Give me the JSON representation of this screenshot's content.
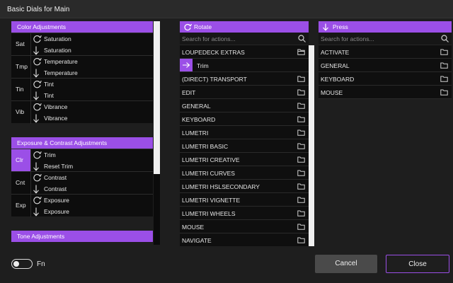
{
  "window": {
    "title": "Basic Dials for Main"
  },
  "left": {
    "sections": [
      {
        "header": "Color Adjustments",
        "rows": [
          {
            "label": "Sat",
            "rotate": "Saturation",
            "press": "Saturation",
            "active": false
          },
          {
            "label": "Tmp",
            "rotate": "Temperature",
            "press": "Temperature",
            "active": false
          },
          {
            "label": "Tin",
            "rotate": "Tint",
            "press": "Tint",
            "active": false
          },
          {
            "label": "Vib",
            "rotate": "Vibrance",
            "press": "Vibrance",
            "active": false
          }
        ]
      },
      {
        "header": "Exposure & Contrast Adjustments",
        "rows": [
          {
            "label": "Clr",
            "rotate": "Trim",
            "press": "Reset Trim",
            "active": true
          },
          {
            "label": "Cnt",
            "rotate": "Contrast",
            "press": "Contrast",
            "active": false
          },
          {
            "label": "Exp",
            "rotate": "Exposure",
            "press": "Exposure",
            "active": false
          }
        ]
      },
      {
        "header": "Tone Adjustments",
        "rows": []
      }
    ]
  },
  "rotate": {
    "header": "Rotate",
    "search_placeholder": "Search for actions...",
    "items": [
      {
        "label": "LOUPEDECK EXTRAS",
        "type": "folder-open"
      },
      {
        "label": "Trim",
        "type": "child"
      },
      {
        "label": "(DIRECT) TRANSPORT",
        "type": "folder"
      },
      {
        "label": "EDIT",
        "type": "folder"
      },
      {
        "label": "GENERAL",
        "type": "folder"
      },
      {
        "label": "KEYBOARD",
        "type": "folder"
      },
      {
        "label": "LUMETRI",
        "type": "folder"
      },
      {
        "label": "LUMETRI BASIC",
        "type": "folder"
      },
      {
        "label": "LUMETRI CREATIVE",
        "type": "folder"
      },
      {
        "label": "LUMETRI CURVES",
        "type": "folder"
      },
      {
        "label": "LUMETRI HSLSECONDARY",
        "type": "folder"
      },
      {
        "label": "LUMETRI VIGNETTE",
        "type": "folder"
      },
      {
        "label": "LUMETRI WHEELS",
        "type": "folder"
      },
      {
        "label": "MOUSE",
        "type": "folder"
      },
      {
        "label": "NAVIGATE",
        "type": "folder"
      }
    ]
  },
  "press": {
    "header": "Press",
    "search_placeholder": "Search for actions...",
    "items": [
      {
        "label": "ACTIVATE",
        "type": "folder"
      },
      {
        "label": "GENERAL",
        "type": "folder"
      },
      {
        "label": "KEYBOARD",
        "type": "folder"
      },
      {
        "label": "MOUSE",
        "type": "folder"
      }
    ]
  },
  "footer": {
    "fn_label": "Fn",
    "cancel_label": "Cancel",
    "close_label": "Close"
  },
  "colors": {
    "accent": "#9b4fe7",
    "background": "#1e1e1e",
    "row_bg": "#0d0d0d"
  }
}
